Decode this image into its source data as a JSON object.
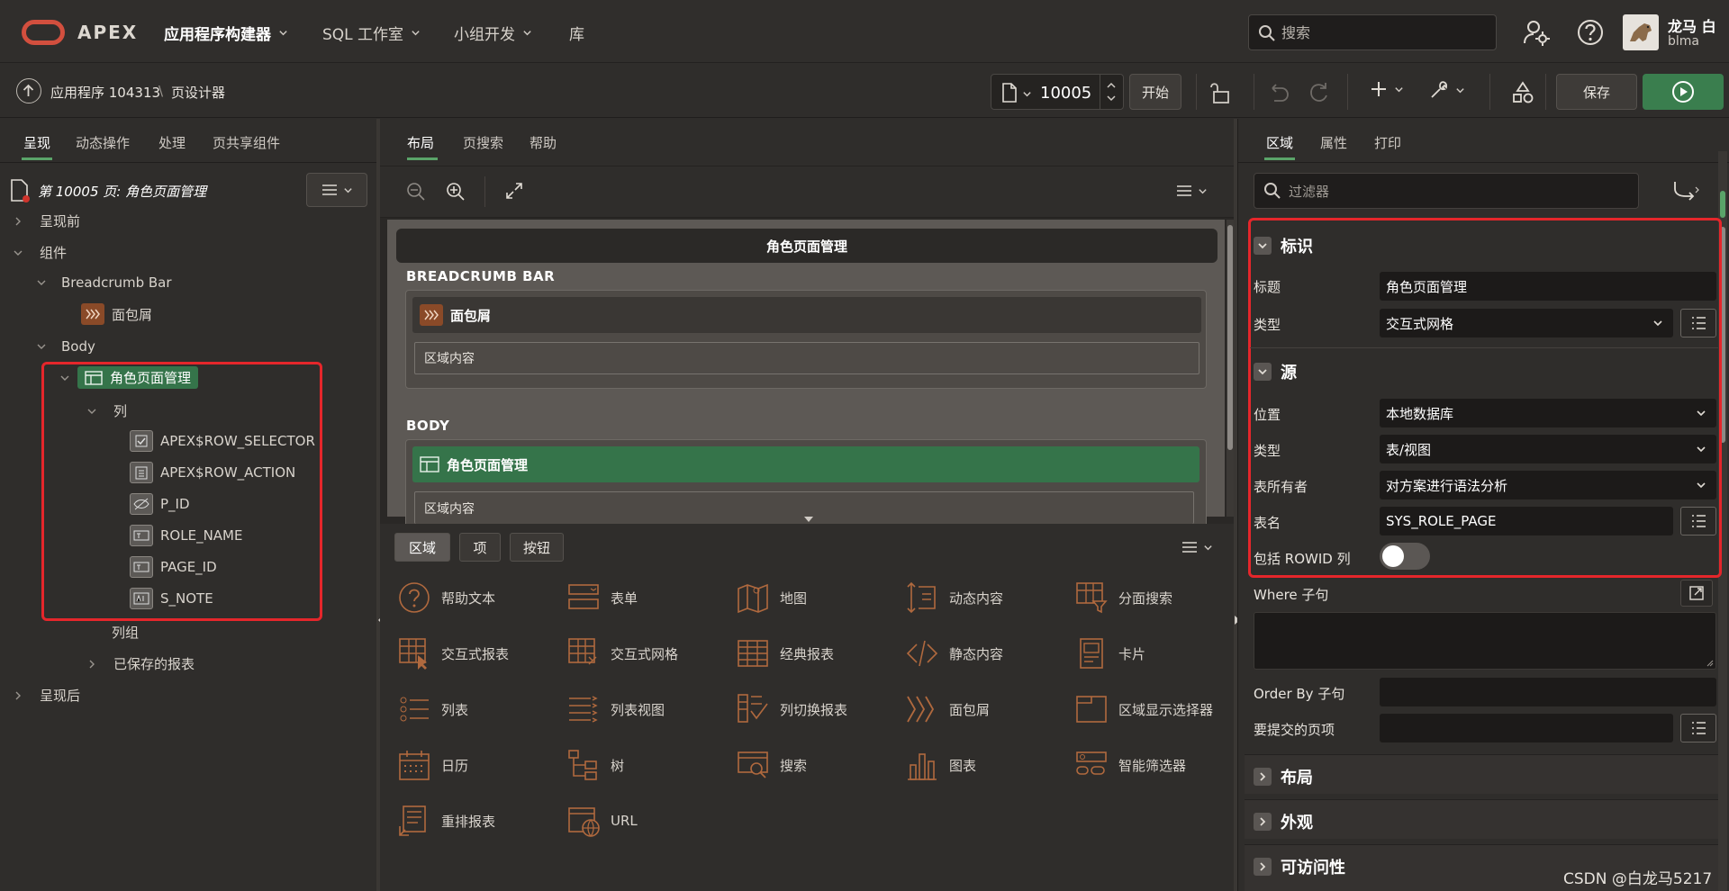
{
  "app": {
    "brand": "APEX"
  },
  "topnav": [
    {
      "label": "应用程序构建器",
      "active": true
    },
    {
      "label": "SQL 工作室"
    },
    {
      "label": "小组开发"
    },
    {
      "label": "库"
    }
  ],
  "search": {
    "placeholder": "搜索"
  },
  "user": {
    "name": "龙马 白",
    "login": "blma"
  },
  "breadcrumb": {
    "app": "应用程序 104313",
    "sep": "\\",
    "current": "页设计器"
  },
  "page_nav": {
    "page_number": "10005",
    "go_label": "开始"
  },
  "actions": {
    "save_label": "保存"
  },
  "left": {
    "tabs": [
      "呈现",
      "动态操作",
      "处理",
      "页共享组件"
    ],
    "page_title": "第 10005 页: 角色页面管理",
    "tree": {
      "before_render": "呈现前",
      "components": "组件",
      "breadcrumb_bar": "Breadcrumb Bar",
      "breadcrumb_region": "面包屑",
      "body": "Body",
      "grid_region": "角色页面管理",
      "columns": "列",
      "column_items": [
        "APEX$ROW_SELECTOR",
        "APEX$ROW_ACTION",
        "P_ID",
        "ROLE_NAME",
        "PAGE_ID",
        "S_NOTE"
      ],
      "column_groups": "列组",
      "saved_reports": "已保存的报表",
      "after_render": "呈现后"
    }
  },
  "center": {
    "tabs": [
      "布局",
      "页搜索",
      "帮助"
    ],
    "canvas": {
      "page_title": "角色页面管理",
      "breadcrumb_bar_label": "BREADCRUMB BAR",
      "breadcrumb_region": "面包屑",
      "region_content": "区域内容",
      "body_label": "BODY",
      "grid_region": "角色页面管理",
      "grid_content": "区域内容"
    },
    "gallery_tabs": [
      "区域",
      "项",
      "按钮"
    ],
    "gallery_items": [
      {
        "label": "帮助文本",
        "icon": "help-icon"
      },
      {
        "label": "表单",
        "icon": "form-icon"
      },
      {
        "label": "地图",
        "icon": "map-icon"
      },
      {
        "label": "动态内容",
        "icon": "dynamic-content-icon"
      },
      {
        "label": "分面搜索",
        "icon": "faceted-search-icon"
      },
      {
        "label": "交互式报表",
        "icon": "interactive-report-icon"
      },
      {
        "label": "交互式网格",
        "icon": "interactive-grid-icon"
      },
      {
        "label": "经典报表",
        "icon": "classic-report-icon"
      },
      {
        "label": "静态内容",
        "icon": "static-content-icon"
      },
      {
        "label": "卡片",
        "icon": "cards-icon"
      },
      {
        "label": "列表",
        "icon": "list-icon"
      },
      {
        "label": "列表视图",
        "icon": "list-view-icon"
      },
      {
        "label": "列切换报表",
        "icon": "column-toggle-icon"
      },
      {
        "label": "面包屑",
        "icon": "breadcrumb-icon"
      },
      {
        "label": "区域显示选择器",
        "icon": "region-selector-icon"
      },
      {
        "label": "日历",
        "icon": "calendar-icon"
      },
      {
        "label": "树",
        "icon": "tree-icon"
      },
      {
        "label": "搜索",
        "icon": "search-region-icon"
      },
      {
        "label": "图表",
        "icon": "chart-icon"
      },
      {
        "label": "智能筛选器",
        "icon": "smart-filter-icon"
      },
      {
        "label": "重排报表",
        "icon": "reflow-report-icon"
      },
      {
        "label": "URL",
        "icon": "url-icon"
      }
    ]
  },
  "right": {
    "tabs": [
      "区域",
      "属性",
      "打印"
    ],
    "filter_placeholder": "过滤器",
    "identification": {
      "heading": "标识",
      "title_label": "标题",
      "title_value": "角色页面管理",
      "type_label": "类型",
      "type_value": "交互式网格"
    },
    "source": {
      "heading": "源",
      "location_label": "位置",
      "location_value": "本地数据库",
      "type_label": "类型",
      "type_value": "表/视图",
      "owner_label": "表所有者",
      "owner_value": "对方案进行语法分析",
      "table_label": "表名",
      "table_value": "SYS_ROLE_PAGE",
      "rowid_label": "包括 ROWID 列",
      "rowid_on": false,
      "where_label": "Where 子句",
      "orderby_label": "Order By 子句",
      "submit_label": "要提交的页项"
    },
    "collapsed_sections": [
      "布局",
      "外观",
      "可访问性"
    ]
  },
  "watermark": "CSDN @白龙马5217",
  "colors": {
    "accent_green": "#3a7e4e",
    "highlight_red": "#e5262b",
    "icon_orange": "#b0693e"
  }
}
